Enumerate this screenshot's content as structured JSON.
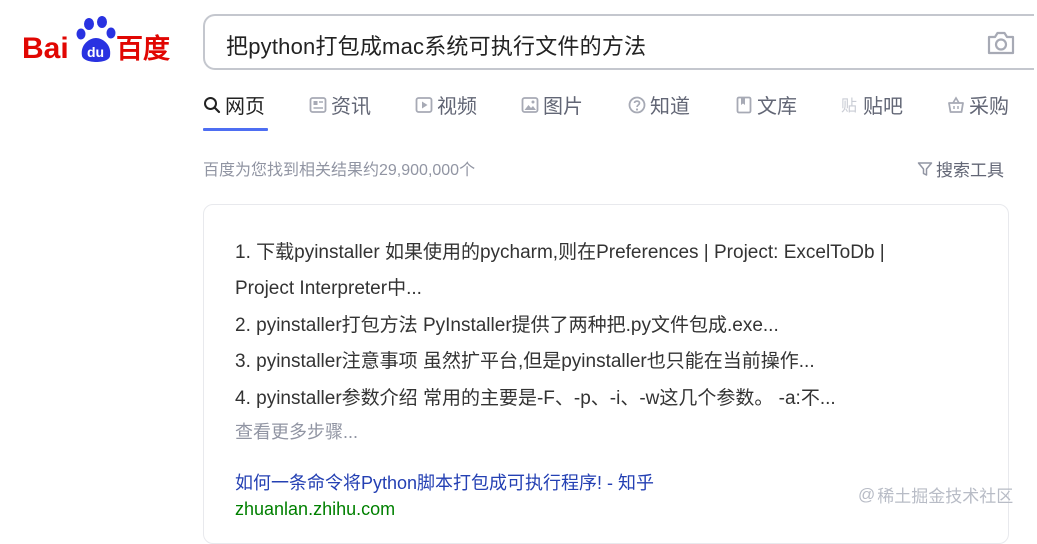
{
  "logo": {
    "text_left": "Bai",
    "text_paw": "du",
    "text_right": "百度"
  },
  "search": {
    "query": "把python打包成mac系统可执行文件的方法"
  },
  "tabs": [
    {
      "label": "网页",
      "icon": "search-icon",
      "active": true
    },
    {
      "label": "资讯",
      "icon": "news-icon",
      "active": false
    },
    {
      "label": "视频",
      "icon": "video-icon",
      "active": false
    },
    {
      "label": "图片",
      "icon": "image-icon",
      "active": false
    },
    {
      "label": "知道",
      "icon": "question-icon",
      "active": false
    },
    {
      "label": "文库",
      "icon": "document-icon",
      "active": false
    },
    {
      "label": "贴吧",
      "icon": "tieba-icon",
      "active": false
    },
    {
      "label": "采购",
      "icon": "basket-icon",
      "active": false
    }
  ],
  "results_summary": {
    "count_text": "百度为您找到相关结果约29,900,000个",
    "tools_label": "搜索工具"
  },
  "result": {
    "steps": [
      "1. 下载pyinstaller 如果使用的pycharm,则在Preferences | Project: ExcelToDb |",
      "Project Interpreter中...",
      "2. pyinstaller打包方法 PyInstaller提供了两种把.py文件包成.exe...",
      "3. pyinstaller注意事项 虽然扩平台,但是pyinstaller也只能在当前操作...",
      "4. pyinstaller参数介绍 常用的主要是-F、-p、-i、-w这几个参数。 -a:不..."
    ],
    "more_steps": "查看更多步骤...",
    "title": "如何一条命令将Python脚本打包成可执行程序! - 知乎",
    "url": "zhuanlan.zhihu.com"
  },
  "watermark": {
    "at": "@",
    "text": "稀土掘金技术社区"
  },
  "colors": {
    "brand_blue": "#2932e1",
    "brand_red": "#e10602",
    "tab_accent": "#4e6ef2",
    "link": "#2440b3",
    "url_green": "#008000"
  }
}
